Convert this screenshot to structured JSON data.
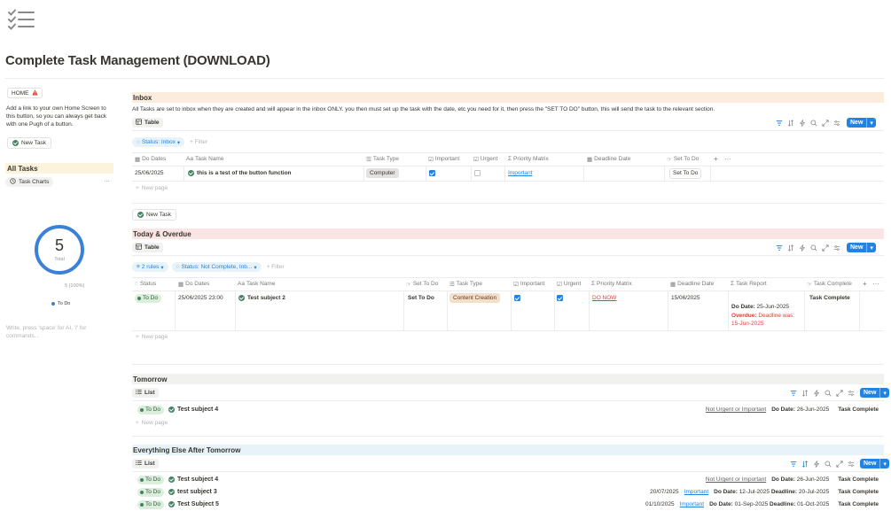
{
  "page": {
    "title": "Complete Task Management (DOWNLOAD)",
    "icon": "checklist-icon"
  },
  "sidebar": {
    "home_button": "HOME",
    "home_desc": "Add a link to your own Home Screen to this button, so you can always get back with one Pugh of a button.",
    "new_task": "New Task",
    "all_tasks_heading": "All Tasks",
    "task_charts_tab": "Task Charts",
    "donut": {
      "value": "5",
      "label": "Total",
      "count": "5 (100%)",
      "legend": "To Do",
      "color": "#3b82d6"
    },
    "placeholder": "Write, press 'space' for AI, '/' for commands..."
  },
  "inbox": {
    "heading": "Inbox",
    "desc": "All Tasks are set to inbox when they are created and will appear in the inbox ONLY. you then must set up the task with the date, etc you need for it, then press the \"SET TO DO\" button, this will send the task to the relevant section.",
    "view": "Table",
    "filter": "Status: Inbox",
    "add_filter": "+ Filter",
    "new": "New",
    "columns": [
      "Do Dates",
      "Task Name",
      "Task Type",
      "Important",
      "Urgent",
      "Priority Matrix",
      "Deadline Date",
      "Set To Do"
    ],
    "row": {
      "do_dates": "25/06/2025",
      "task_name": "this is a test of the button function",
      "task_type": "Computer",
      "priority": "Important",
      "set_to_do": "Set To Do"
    },
    "new_page": "New page",
    "new_task_button": "New Task"
  },
  "today": {
    "heading": "Today & Overdue",
    "view": "Table",
    "rules": "2 rules",
    "filter": "Status: Not Complete, Inb...",
    "add_filter": "+ Filter",
    "new": "New",
    "columns": [
      "Status",
      "Do Dates",
      "Task Name",
      "Set To Do",
      "Task Type",
      "Important",
      "Urgent",
      "Priority Matrix",
      "Deadline Date",
      "Task Report",
      "Task Complete"
    ],
    "row": {
      "status": "To Do",
      "do_dates": "25/06/2025 23:00",
      "task_name": "Test subject 2",
      "set_to_do": "Set To Do",
      "task_type": "Content Creation",
      "priority": "DO NOW",
      "deadline": "15/06/2025",
      "report_do_label": "Do Date:",
      "report_do_value": "25-Jun-2025",
      "report_overdue_label": "Overdue:",
      "report_overdue_line1": "Deadline was:",
      "report_overdue_line2": "15-Jun-2025",
      "task_complete": "Task Complete"
    },
    "new_page": "New page"
  },
  "tomorrow": {
    "heading": "Tomorrow",
    "view": "List",
    "new": "New",
    "items": [
      {
        "status": "To Do",
        "name": "Test subject 4",
        "matrix": "Not Urgent or Important",
        "do_label": "Do Date:",
        "do_date": "26-Jun-2025",
        "complete": "Task Complete"
      }
    ],
    "new_page": "New page"
  },
  "everything": {
    "heading": "Everything Else After Tomorrow",
    "view": "List",
    "new": "New",
    "items": [
      {
        "status": "To Do",
        "name": "Test subject 4",
        "date": "",
        "matrix": "Not Urgent or Important",
        "do_label": "Do Date:",
        "do_date": "26-Jun-2025",
        "dl_label": "",
        "deadline": "",
        "complete": "Task Complete"
      },
      {
        "status": "To Do",
        "name": "test subject 3",
        "date": "20/07/2025",
        "matrix": "Important",
        "do_label": "Do Date:",
        "do_date": "12-Jul-2025",
        "dl_label": "Deadline:",
        "deadline": "20-Jul-2025",
        "complete": "Task Complete"
      },
      {
        "status": "To Do",
        "name": "Test Subject 5",
        "date": "01/10/2025",
        "matrix": "Important",
        "do_label": "Do Date:",
        "do_date": "01-Sep-2025",
        "dl_label": "Deadline:",
        "deadline": "01-Oct-2025",
        "complete": "Task Complete"
      }
    ]
  },
  "colors": {
    "accent": "#2383e2",
    "inbox_bg": "#fbecdd",
    "today_bg": "#fbe4e4",
    "tomorrow_bg": "#f1f1ef",
    "everything_bg": "#e7f3f8",
    "all_tasks_bg": "#fbf3db"
  }
}
